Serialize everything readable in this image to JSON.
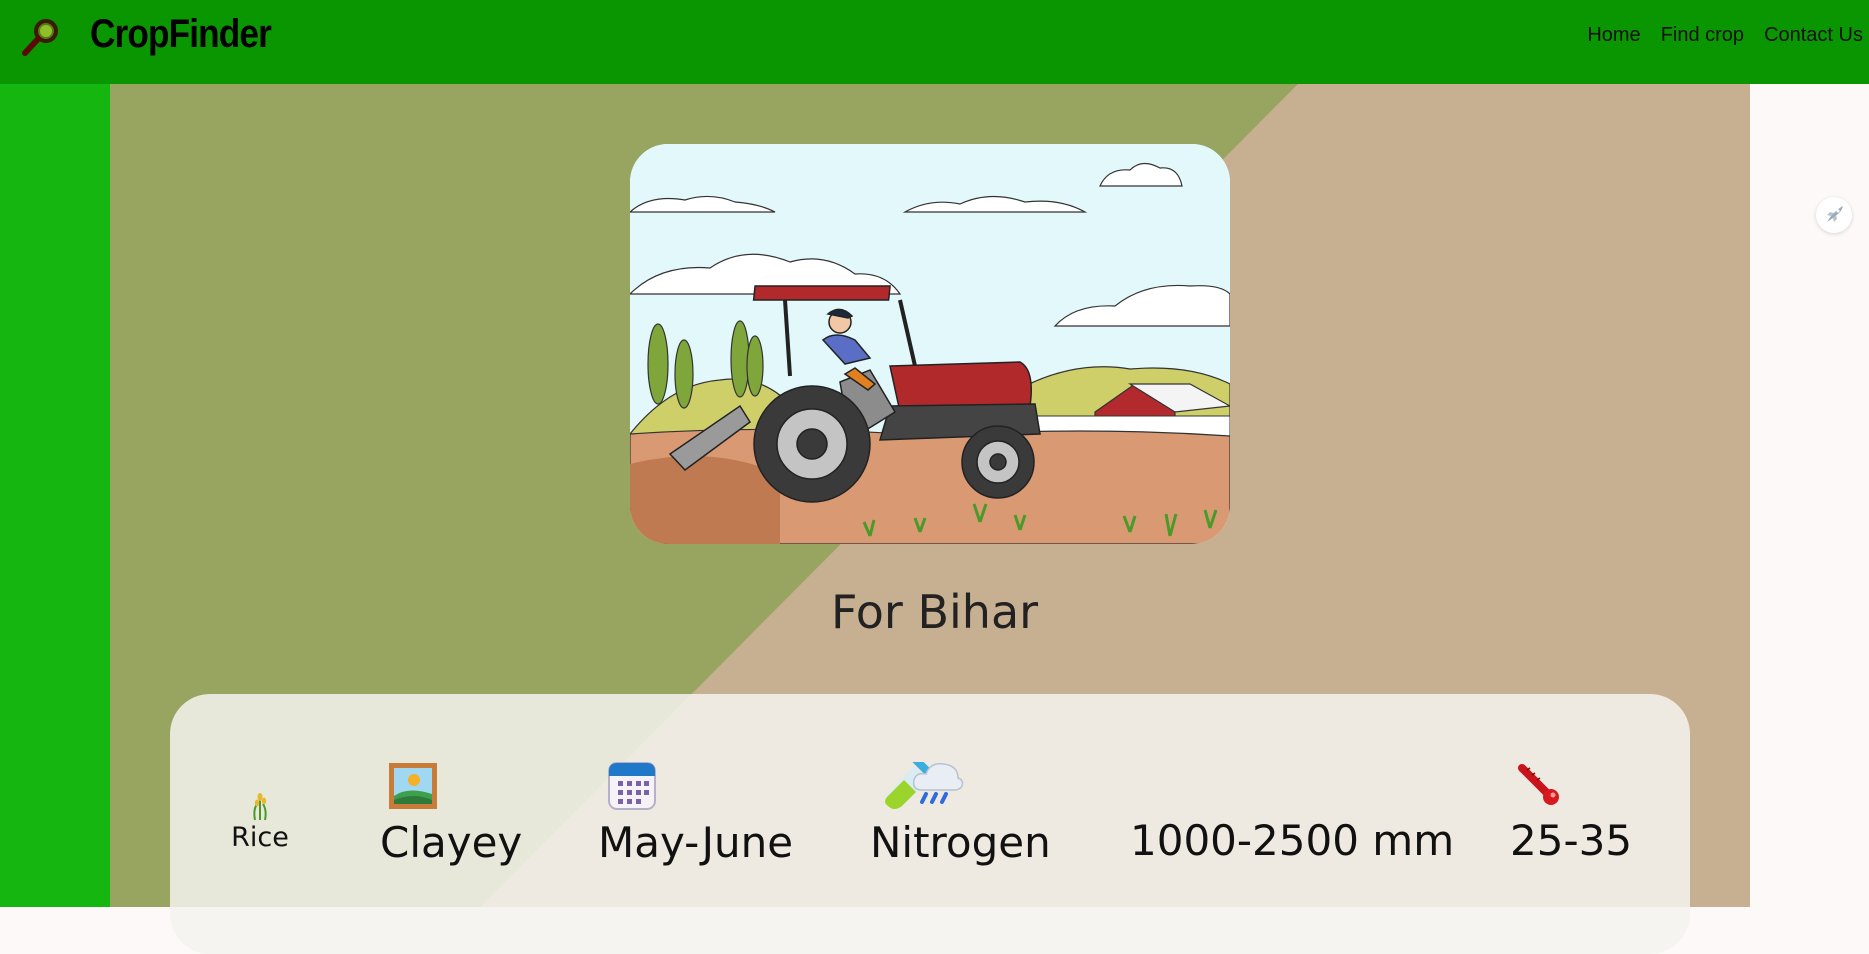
{
  "brand": "CropFinder",
  "nav": {
    "items": [
      {
        "label": "Home"
      },
      {
        "label": "Find crop"
      },
      {
        "label": "Contact Us"
      }
    ]
  },
  "hero": {
    "heading": "For Bihar"
  },
  "info": {
    "crop": {
      "label": "Rice",
      "icon": "rice-plant-icon"
    },
    "soil": {
      "label": "Clayey",
      "icon": "framed-landscape-icon"
    },
    "season": {
      "label": "May-June",
      "icon": "calendar-icon"
    },
    "nutrient": {
      "label": "Nitrogen",
      "icon": "test-tube-icon"
    },
    "rainfall": {
      "label": "1000-2500 mm",
      "icon": "rain-cloud-icon"
    },
    "temperature": {
      "label": "25-35",
      "icon": "thermometer-icon"
    }
  },
  "colors": {
    "navbar": "#0a9600",
    "left_strip": "#14b60f",
    "hero_green": "#98a561",
    "hero_tan": "#c6b091"
  }
}
